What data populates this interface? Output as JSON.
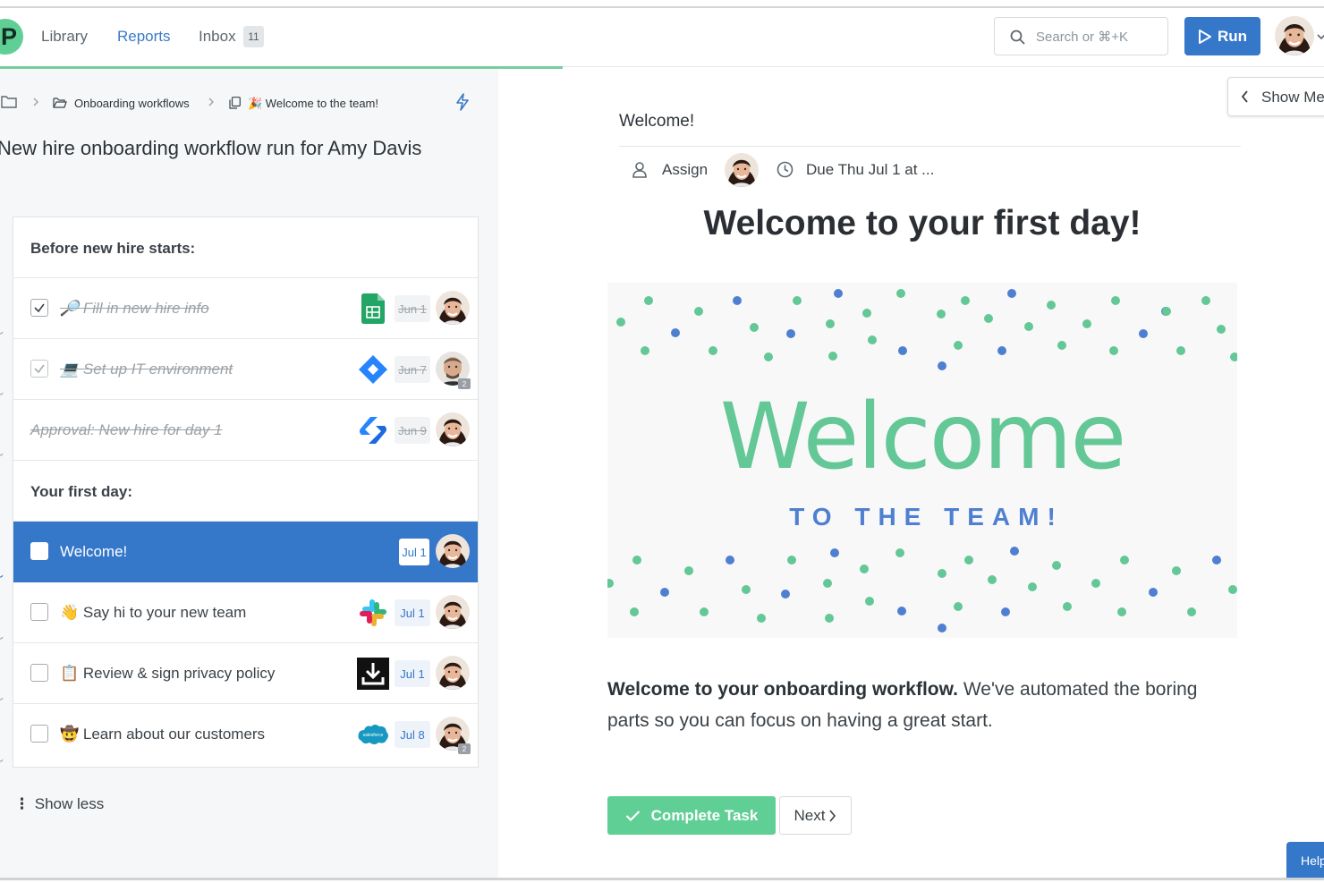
{
  "brand": {
    "logo_letter": "P",
    "accent": "#3577c9",
    "success": "#5fcf95"
  },
  "nav": {
    "items": [
      {
        "label": "Library",
        "active": false
      },
      {
        "label": "Reports",
        "active": true
      },
      {
        "label": "Inbox",
        "active": false
      }
    ],
    "inbox_count": "11"
  },
  "search": {
    "placeholder": "Search or ⌘+K"
  },
  "run_button": {
    "label": "Run"
  },
  "breadcrumb": {
    "folder": "Onboarding workflows",
    "current": "🎉 Welcome to the team!"
  },
  "run": {
    "title": "New hire onboarding workflow run for Amy Davis"
  },
  "checklist": {
    "sections": [
      {
        "heading": "Before new hire starts:",
        "tasks": [
          {
            "label": "🔎 Fill in new hire info",
            "due": "Jun 1",
            "done": true,
            "checked": true,
            "app_icon": "sheets-icon",
            "assignee_badge": ""
          },
          {
            "label": "💻 Set up IT environment",
            "due": "Jun 7",
            "done": true,
            "checked": true,
            "app_icon": "jira-icon",
            "assignee_badge": "2"
          },
          {
            "label": "Approval: New hire for day 1",
            "due": "Jun 9",
            "done": true,
            "checked": false,
            "app_icon": "jira-alt-icon",
            "assignee_badge": ""
          }
        ]
      },
      {
        "heading": "Your first day:",
        "tasks": [
          {
            "label": "Welcome!",
            "due": "Jul 1",
            "done": false,
            "selected": true,
            "app_icon": "",
            "assignee_badge": ""
          },
          {
            "label": "👋 Say hi to your new team",
            "due": "Jul 1",
            "done": false,
            "app_icon": "slack-icon",
            "assignee_badge": ""
          },
          {
            "label": "📋 Review & sign privacy policy",
            "due": "Jul 1",
            "done": false,
            "app_icon": "download-icon",
            "assignee_badge": ""
          },
          {
            "label": "🤠 Learn about our customers",
            "due": "Jul 8",
            "done": false,
            "app_icon": "salesforce-icon",
            "assignee_badge": "2"
          }
        ]
      }
    ],
    "show_less": "Show less"
  },
  "task": {
    "name": "Welcome!",
    "assign_label": "Assign",
    "due_label": "Due Thu Jul 1 at ...",
    "headline": "Welcome to your first day!",
    "banner": {
      "big": "Welcome",
      "small": "TO THE TEAM!",
      "green": "#63c796",
      "blue": "#4f7fd0"
    },
    "body_bold": "Welcome to your onboarding workflow.",
    "body_rest": " We've automated the boring parts so you can focus on having a great start.",
    "complete_label": "Complete Task",
    "next_label": "Next"
  },
  "show_me": {
    "label": "Show Me"
  },
  "help": {
    "label": "Help"
  },
  "salesforce_text": "salesforce"
}
